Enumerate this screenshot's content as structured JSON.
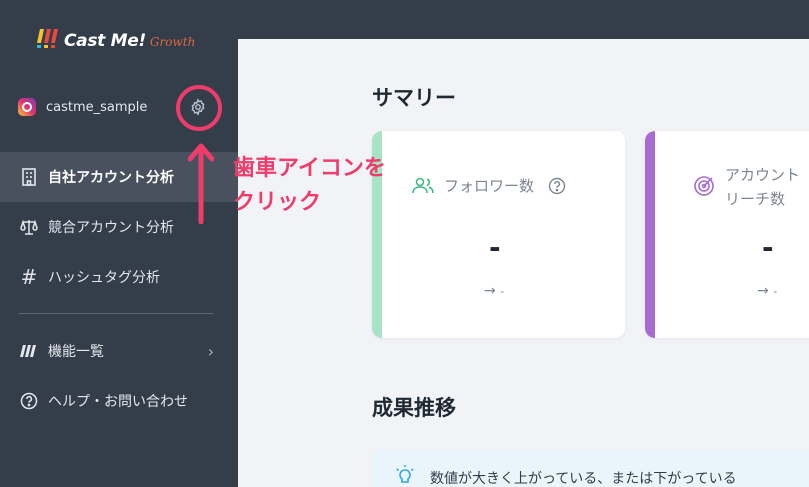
{
  "brand": {
    "name": "Cast Me!",
    "sub": "Growth"
  },
  "account": {
    "name": "castme_sample"
  },
  "nav": [
    {
      "label": "自社アカウント分析",
      "icon": "building-icon",
      "active": true
    },
    {
      "label": "競合アカウント分析",
      "icon": "scale-icon",
      "active": false
    },
    {
      "label": "ハッシュタグ分析",
      "icon": "hashtag-icon",
      "active": false
    }
  ],
  "nav2": [
    {
      "label": "機能一覧",
      "icon": "castme-mark-icon"
    },
    {
      "label": "ヘルプ・お問い合わせ",
      "icon": "help-icon"
    }
  ],
  "summary": {
    "title": "サマリー",
    "cards": [
      {
        "label": "フォロワー数",
        "value": "-",
        "change": "-",
        "accent": "#a8e3c6",
        "icon": "users-icon",
        "icon_color": "#3dba85"
      },
      {
        "label_line1": "アカウント",
        "label_line2": "リーチ数",
        "value": "-",
        "change": "-",
        "accent": "#a86bd1",
        "icon": "target-icon",
        "icon_color": "#a86bd1"
      }
    ]
  },
  "trend": {
    "title": "成果推移",
    "info": "数値が大きく上がっている、または下がっている"
  },
  "annotation": {
    "text": "歯車アイコンを\nクリック",
    "color": "#ee3c6b"
  }
}
